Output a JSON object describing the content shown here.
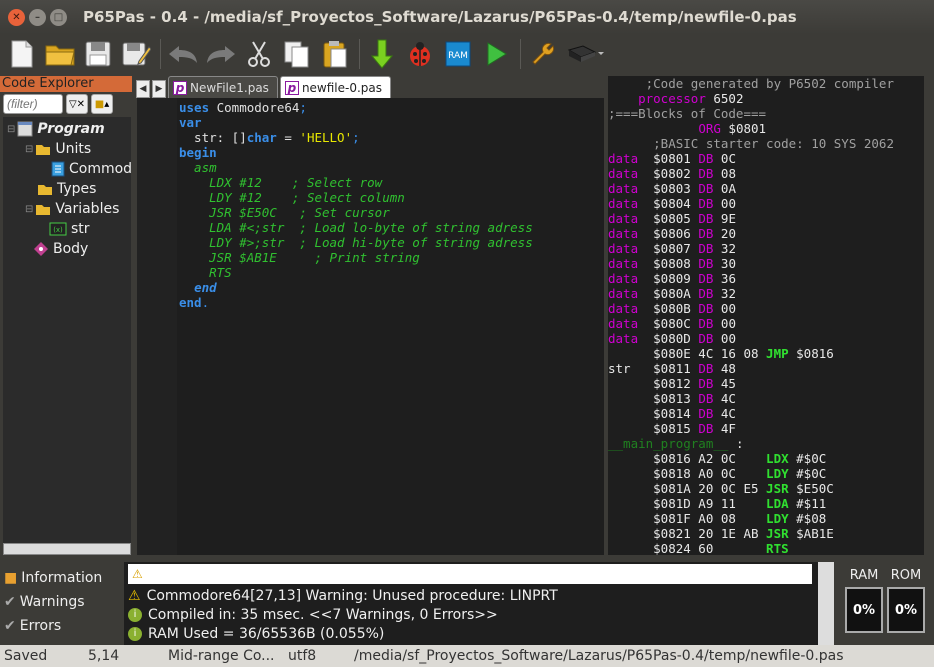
{
  "window": {
    "title": "P65Pas - 0.4 - /media/sf_Proyectos_Software/Lazarus/P65Pas-0.4/temp/newfile-0.pas"
  },
  "code_explorer": {
    "header": "Code Explorer",
    "filter_placeholder": "(filter)",
    "tree": [
      {
        "label": "Program",
        "icon": "program-icon"
      },
      {
        "label": "Units",
        "icon": "folder-icon"
      },
      {
        "label": "Commod",
        "icon": "unit-icon"
      },
      {
        "label": "Types",
        "icon": "folder-icon"
      },
      {
        "label": "Variables",
        "icon": "folder-icon"
      },
      {
        "label": "str",
        "icon": "variable-icon"
      },
      {
        "label": "Body",
        "icon": "body-icon"
      }
    ]
  },
  "tabs": [
    {
      "label": "NewFile1.pas",
      "active": false
    },
    {
      "label": "newfile-0.pas",
      "active": true
    }
  ],
  "editor": {
    "lines": [
      "uses Commodore64;",
      "var",
      "  str: []char = 'HELLO';",
      "begin",
      "  asm",
      "    LDX #12    ; Select row",
      "    LDY #12    ; Select column",
      "    JSR $E50C   ; Set cursor",
      "    LDA #<str  ; Load lo-byte of string adress",
      "    LDY #>str  ; Load hi-byte of string adress",
      "    JSR $AB1E     ; Print string",
      "    RTS",
      "  end",
      "end."
    ]
  },
  "asm_output": [
    "     ;Code generated by P6502 compiler",
    "    processor 6502",
    ";===Blocks of Code===",
    "            ORG $0801",
    "      ;BASIC starter code: 10 SYS 2062",
    "data  $0801 DB 0C",
    "data  $0802 DB 08",
    "data  $0803 DB 0A",
    "data  $0804 DB 00",
    "data  $0805 DB 9E",
    "data  $0806 DB 20",
    "data  $0807 DB 32",
    "data  $0808 DB 30",
    "data  $0809 DB 36",
    "data  $080A DB 32",
    "data  $080B DB 00",
    "data  $080C DB 00",
    "data  $080D DB 00",
    "      $080E 4C 16 08 JMP $0816",
    "str   $0811 DB 48",
    "      $0812 DB 45",
    "      $0813 DB 4C",
    "      $0814 DB 4C",
    "      $0815 DB 4F",
    "__main_program__ :",
    "      $0816 A2 0C    LDX #$0C",
    "      $0818 A0 0C    LDY #$0C",
    "      $081A 20 0C E5 JSR $E50C",
    "      $081D A9 11    LDA #$11",
    "      $081F A0 08    LDY #$08",
    "      $0821 20 1E AB JSR $AB1E",
    "      $0824 60       RTS"
  ],
  "messages": {
    "categories": [
      "Information",
      "Warnings",
      "Errors"
    ],
    "lines": [
      {
        "icon": "warning-icon",
        "text": "Commodore64[27,13] Warning: Unused procedure: LINPRT"
      },
      {
        "icon": "info-icon",
        "text": "Compiled in: 35 msec. <<7 Warnings, 0 Errors>>"
      },
      {
        "icon": "info-icon",
        "text": "RAM Used   = 36/65536B (0.055%)"
      }
    ]
  },
  "meters": {
    "ram": {
      "label": "RAM",
      "value": "0%"
    },
    "rom": {
      "label": "ROM",
      "value": "0%"
    }
  },
  "status": {
    "state": "Saved",
    "position": "5,14",
    "device": "Mid-range Co...",
    "encoding": "utf8",
    "path": "/media/sf_Proyectos_Software/Lazarus/P65Pas-0.4/temp/newfile-0.pas"
  },
  "colors": {
    "accent": "#d46a38",
    "keyword": "#3a8ee8",
    "comment": "#30c030",
    "asm_keyword": "#d000d0"
  }
}
